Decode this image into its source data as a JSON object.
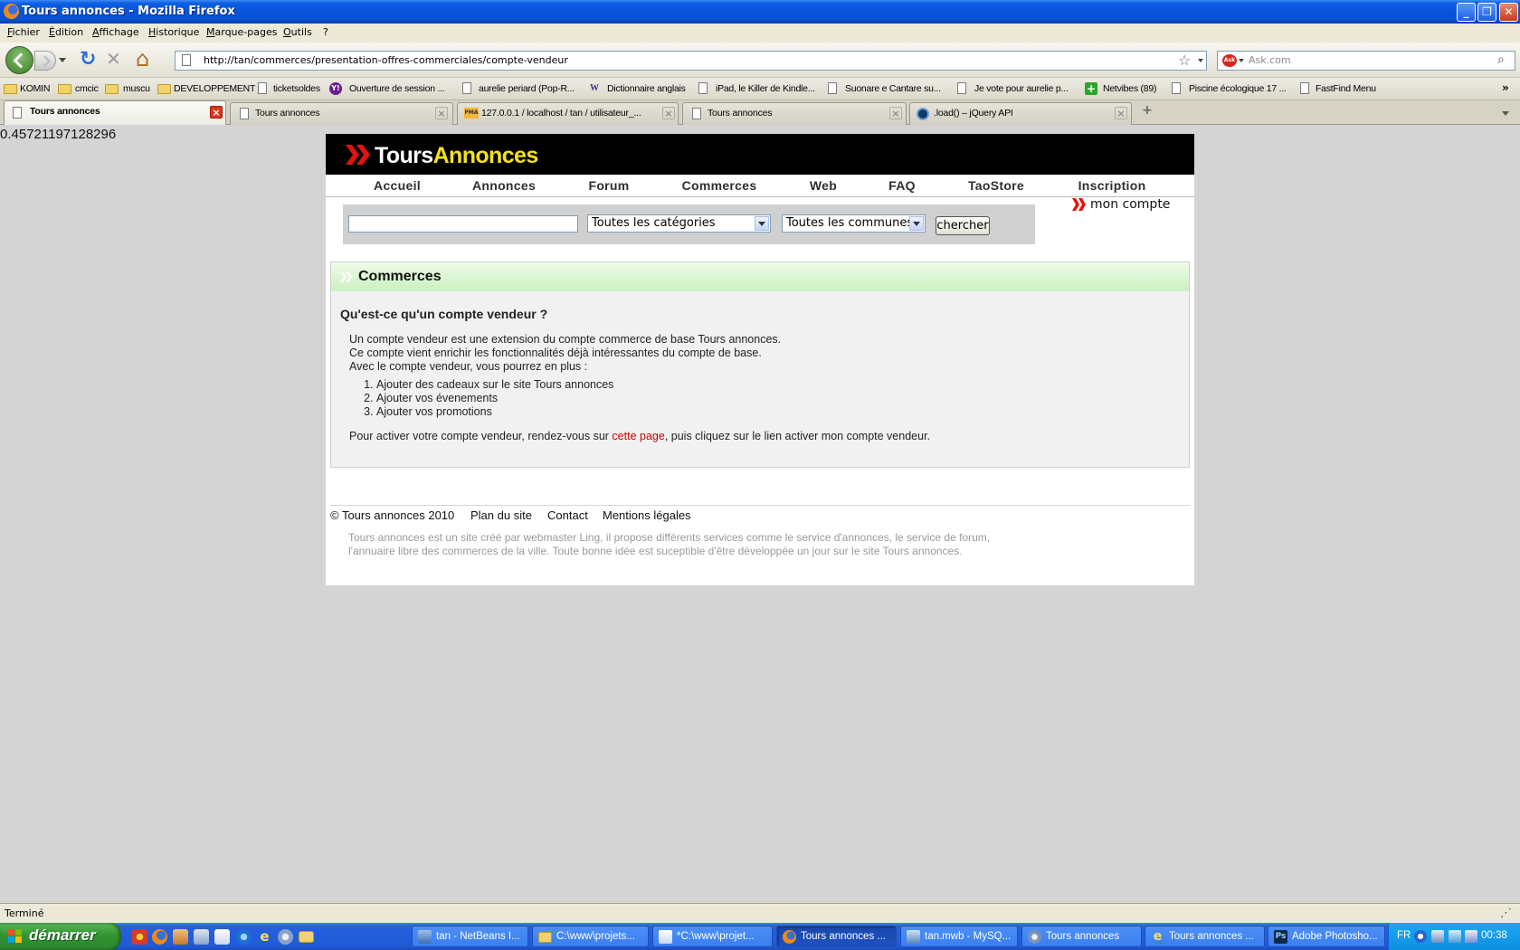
{
  "window": {
    "title": "Tours annonces - Mozilla Firefox"
  },
  "menu": [
    "Fichier",
    "Édition",
    "Affichage",
    "Historique",
    "Marque-pages",
    "Outils",
    "?"
  ],
  "nav": {
    "url": "http://tan/commerces/presentation-offres-commerciales/compte-vendeur",
    "search_placeholder": "Ask.com",
    "search_engine_icon": "ask-icon"
  },
  "bookmarks": [
    {
      "label": "KOMIN",
      "icon": "folder-icon"
    },
    {
      "label": "cmcic",
      "icon": "folder-icon"
    },
    {
      "label": "muscu",
      "icon": "folder-icon"
    },
    {
      "label": "DEVELOPPEMENT",
      "icon": "folder-icon"
    },
    {
      "label": "ticketsoldes",
      "icon": "page-icon"
    },
    {
      "label": "Ouverture de session ...",
      "icon": "yahoo-icon"
    },
    {
      "label": "aurelie periard (Pop-R...",
      "icon": "page-icon"
    },
    {
      "label": "Dictionnaire anglais",
      "icon": "wordreference-icon"
    },
    {
      "label": "iPad, le Killer de Kindle...",
      "icon": "page-icon"
    },
    {
      "label": "Suonare e Cantare su...",
      "icon": "page-icon"
    },
    {
      "label": "Je vote pour aurelie p...",
      "icon": "page-icon"
    },
    {
      "label": "Netvibes (89)",
      "icon": "netvibes-plus-icon"
    },
    {
      "label": "Piscine écologique 17 ...",
      "icon": "page-icon"
    },
    {
      "label": "FastFind Menu",
      "icon": "page-icon"
    }
  ],
  "tabs": [
    {
      "label": "Tours annonces",
      "icon": "page-icon",
      "active": true
    },
    {
      "label": "Tours annonces",
      "icon": "page-icon",
      "active": false
    },
    {
      "label": "127.0.0.1 / localhost / tan / utilisateur_...",
      "icon": "phpmyadmin-icon",
      "active": false
    },
    {
      "label": "Tours annonces",
      "icon": "page-icon",
      "active": false
    },
    {
      "label": ".load() – jQuery API",
      "icon": "jquery-icon",
      "active": false
    }
  ],
  "page": {
    "debug_value": "0.45721197128296"
  },
  "site": {
    "logo": {
      "part1": "Tours",
      "part2": "Annonces"
    },
    "nav": [
      "Accueil",
      "Annonces",
      "Forum",
      "Commerces",
      "Web",
      "FAQ",
      "TaoStore",
      "Inscription"
    ],
    "search": {
      "input_value": "",
      "category": "Toutes les catégories",
      "commune": "Toutes les communes",
      "button": "chercher"
    },
    "account_link": "mon compte",
    "panel": {
      "title": "Commerces",
      "heading": "Qu'est-ce qu'un compte vendeur ?",
      "intro": [
        "Un compte vendeur est une extension du compte commerce de base Tours annonces.",
        "Ce compte vient enrichir les fonctionnalités déjà intéressantes du compte de base.",
        "Avec le compte vendeur, vous pourrez en plus :"
      ],
      "list": [
        "Ajouter des cadeaux sur le site Tours annonces",
        "Ajouter vos évenements",
        "Ajouter vos promotions"
      ],
      "activate": {
        "before": "Pour activer votre compte vendeur, rendez-vous sur ",
        "link": "cette page",
        "after": ", puis cliquez sur le lien activer mon compte vendeur."
      }
    },
    "footer": {
      "links": [
        "© Tours annonces 2010",
        "Plan du site",
        "Contact",
        "Mentions légales"
      ],
      "description": [
        "Tours annonces est un site créé par webmaster Ling, il propose différents services comme le service d'annonces, le service de forum,",
        "l'annuaire libre des commerces de la ville. Toute bonne idée est suceptible d'être développée un jour sur le site Tours annonces."
      ]
    }
  },
  "status": {
    "text": "Terminé"
  },
  "taskbar": {
    "start": "démarrer",
    "tasks": [
      {
        "label": "tan - NetBeans I...",
        "icon": "netbeans-icon",
        "active": false
      },
      {
        "label": "C:\\www\\projets...",
        "icon": "folder-icon",
        "active": false
      },
      {
        "label": "*C:\\www\\projet...",
        "icon": "notepad-icon",
        "active": false
      },
      {
        "label": "Tours annonces ...",
        "icon": "firefox-icon",
        "active": true
      },
      {
        "label": "tan.mwb - MySQ...",
        "icon": "mysql-workbench-icon",
        "active": false
      },
      {
        "label": "Tours annonces",
        "icon": "browser-icon",
        "active": false
      },
      {
        "label": "Tours annonces ...",
        "icon": "ie-icon",
        "active": false
      },
      {
        "label": "Adobe Photosho...",
        "icon": "photoshop-icon",
        "active": false
      }
    ],
    "lang": "FR",
    "clock": "00:38"
  },
  "colors": {
    "brand_yellow": "#f5e21c",
    "brand_red": "#e0140f",
    "link_red": "#cc0000",
    "panel_header_green": "#cdf0c0",
    "page_background": "#d4d4d4"
  }
}
